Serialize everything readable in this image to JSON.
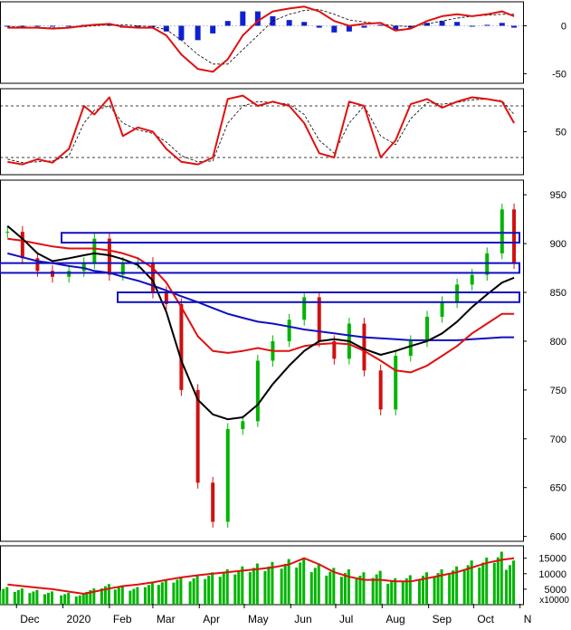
{
  "chart_data": [
    {
      "type": "line",
      "panel": "macd",
      "y_ticks": [
        "0",
        "-50"
      ],
      "ylim": [
        -60,
        25
      ],
      "series": [],
      "x": [
        "2019-11-25",
        "2019-12-05",
        "2019-12-15",
        "2019-12-25",
        "2020-01-05",
        "2020-01-15",
        "2020-01-22",
        "2020-02-01",
        "2020-02-10",
        "2020-02-20",
        "2020-03-01",
        "2020-03-10",
        "2020-03-20",
        "2020-03-31",
        "2020-04-10",
        "2020-04-20",
        "2020-04-30",
        "2020-05-10",
        "2020-05-20",
        "2020-05-31",
        "2020-06-10",
        "2020-06-20",
        "2020-06-30",
        "2020-07-10",
        "2020-07-20",
        "2020-07-31",
        "2020-08-10",
        "2020-08-20",
        "2020-08-31",
        "2020-09-10",
        "2020-09-20",
        "2020-09-30",
        "2020-10-10",
        "2020-10-20",
        "2020-10-28"
      ],
      "macd": [
        -2,
        -2,
        -2,
        -3,
        -2,
        0,
        1,
        2,
        -1,
        -2,
        -2,
        -10,
        -30,
        -45,
        -48,
        -35,
        -10,
        5,
        15,
        18,
        20,
        15,
        5,
        0,
        2,
        3,
        -5,
        -3,
        5,
        10,
        12,
        10,
        12,
        15,
        10
      ],
      "signal": [
        -1,
        -1,
        -2,
        -2,
        -2,
        -1,
        0,
        1,
        1,
        0,
        -1,
        -4,
        -15,
        -30,
        -40,
        -40,
        -25,
        -10,
        5,
        12,
        16,
        17,
        12,
        6,
        4,
        2,
        0,
        -1,
        2,
        5,
        8,
        10,
        11,
        12,
        12
      ],
      "histogram": [
        -1,
        -1,
        0,
        -1,
        0,
        1,
        1,
        1,
        -2,
        -2,
        -1,
        -6,
        -15,
        -15,
        -8,
        5,
        15,
        15,
        10,
        6,
        4,
        -2,
        -7,
        -6,
        -2,
        1,
        -5,
        -2,
        3,
        5,
        4,
        0,
        1,
        3,
        -2
      ]
    },
    {
      "type": "line",
      "panel": "stochastic",
      "y_ticks": [
        "50"
      ],
      "ylim": [
        0,
        100
      ],
      "reference_lines": [
        80,
        20
      ],
      "series": [],
      "x": [
        "2019-11-25",
        "2019-12-05",
        "2019-12-15",
        "2019-12-25",
        "2020-01-05",
        "2020-01-15",
        "2020-01-22",
        "2020-02-01",
        "2020-02-10",
        "2020-02-20",
        "2020-03-01",
        "2020-03-10",
        "2020-03-20",
        "2020-03-31",
        "2020-04-10",
        "2020-04-20",
        "2020-04-30",
        "2020-05-10",
        "2020-05-20",
        "2020-05-31",
        "2020-06-10",
        "2020-06-20",
        "2020-06-30",
        "2020-07-10",
        "2020-07-20",
        "2020-07-31",
        "2020-08-10",
        "2020-08-20",
        "2020-08-31",
        "2020-09-10",
        "2020-09-20",
        "2020-09-30",
        "2020-10-10",
        "2020-10-20",
        "2020-10-28"
      ],
      "k": [
        15,
        12,
        18,
        14,
        30,
        80,
        70,
        90,
        45,
        55,
        50,
        30,
        15,
        12,
        20,
        88,
        92,
        80,
        85,
        80,
        60,
        25,
        20,
        85,
        80,
        20,
        40,
        82,
        88,
        78,
        85,
        90,
        88,
        85,
        60
      ],
      "d": [
        18,
        14,
        15,
        16,
        22,
        60,
        75,
        80,
        60,
        52,
        48,
        38,
        22,
        15,
        16,
        60,
        80,
        85,
        84,
        82,
        70,
        40,
        25,
        60,
        80,
        45,
        35,
        65,
        84,
        82,
        84,
        87,
        88,
        86,
        70
      ]
    },
    {
      "type": "line",
      "panel": "price",
      "y_ticks": [
        "950",
        "900",
        "850",
        "800",
        "750",
        "700",
        "650",
        "600"
      ],
      "ylim": [
        595,
        965
      ],
      "series": [],
      "x": [
        "2019-11-25",
        "2019-12-05",
        "2019-12-15",
        "2019-12-25",
        "2020-01-05",
        "2020-01-15",
        "2020-01-22",
        "2020-02-01",
        "2020-02-10",
        "2020-02-20",
        "2020-03-01",
        "2020-03-10",
        "2020-03-20",
        "2020-03-31",
        "2020-04-10",
        "2020-04-20",
        "2020-04-30",
        "2020-05-10",
        "2020-05-20",
        "2020-05-31",
        "2020-06-10",
        "2020-06-20",
        "2020-06-30",
        "2020-07-10",
        "2020-07-20",
        "2020-07-31",
        "2020-08-10",
        "2020-08-20",
        "2020-08-31",
        "2020-09-10",
        "2020-09-20",
        "2020-09-30",
        "2020-10-10",
        "2020-10-20",
        "2020-10-28"
      ],
      "close": [
        912,
        885,
        872,
        866,
        872,
        880,
        905,
        868,
        880,
        880,
        850,
        838,
        750,
        655,
        615,
        710,
        718,
        780,
        800,
        822,
        845,
        800,
        782,
        818,
        770,
        730,
        785,
        800,
        825,
        840,
        858,
        868,
        890,
        935,
        880
      ],
      "ma_black": [
        918,
        905,
        890,
        882,
        885,
        888,
        890,
        888,
        884,
        878,
        862,
        830,
        780,
        740,
        725,
        720,
        722,
        735,
        756,
        775,
        790,
        800,
        802,
        800,
        792,
        786,
        790,
        795,
        800,
        808,
        820,
        835,
        848,
        860,
        865
      ],
      "ma_red": [
        905,
        903,
        900,
        897,
        895,
        895,
        895,
        893,
        890,
        885,
        875,
        860,
        835,
        805,
        790,
        788,
        790,
        793,
        790,
        790,
        795,
        797,
        798,
        797,
        790,
        780,
        770,
        768,
        775,
        785,
        795,
        808,
        818,
        828,
        828
      ],
      "ma_blue": [
        890,
        886,
        882,
        880,
        877,
        875,
        872,
        870,
        866,
        862,
        857,
        852,
        846,
        840,
        834,
        828,
        824,
        820,
        818,
        815,
        812,
        810,
        808,
        806,
        804,
        803,
        802,
        801,
        801,
        801,
        801,
        802,
        803,
        804,
        804
      ],
      "zones": [
        [
          901,
          911
        ],
        [
          870,
          880
        ],
        [
          840,
          850
        ]
      ]
    },
    {
      "type": "bar",
      "panel": "volume",
      "y_ticks": [
        "15000",
        "10000",
        "5000"
      ],
      "unit_label": "x10000",
      "ylim": [
        0,
        19000
      ],
      "series": [],
      "x": [
        "2019-11-25",
        "2019-12-05",
        "2019-12-15",
        "2019-12-25",
        "2020-01-05",
        "2020-01-15",
        "2020-01-22",
        "2020-02-01",
        "2020-02-10",
        "2020-02-20",
        "2020-03-01",
        "2020-03-10",
        "2020-03-20",
        "2020-03-31",
        "2020-04-10",
        "2020-04-20",
        "2020-04-30",
        "2020-05-10",
        "2020-05-20",
        "2020-05-31",
        "2020-06-10",
        "2020-06-20",
        "2020-06-30",
        "2020-07-10",
        "2020-07-20",
        "2020-07-31",
        "2020-08-10",
        "2020-08-20",
        "2020-08-31",
        "2020-09-10",
        "2020-09-20",
        "2020-09-30",
        "2020-10-10",
        "2020-10-20",
        "2020-10-28"
      ],
      "volume": [
        6000,
        5500,
        5000,
        4500,
        4000,
        3500,
        5500,
        7000,
        6500,
        6000,
        7500,
        8500,
        9500,
        10000,
        11000,
        12000,
        13000,
        14000,
        14500,
        15500,
        16000,
        14000,
        12500,
        12000,
        11000,
        11500,
        9000,
        10000,
        11000,
        12000,
        13000,
        15000,
        16000,
        18000,
        15000
      ],
      "volume_ma": [
        6500,
        6000,
        5500,
        5000,
        4200,
        3500,
        4200,
        5200,
        6000,
        6500,
        7200,
        8000,
        8800,
        9500,
        10000,
        10500,
        11000,
        11500,
        12000,
        13000,
        15000,
        13000,
        10500,
        9000,
        8000,
        8000,
        7500,
        7500,
        8500,
        9500,
        10500,
        12000,
        13500,
        14500,
        15000
      ]
    }
  ],
  "x_axis": {
    "labels": [
      "Dec",
      "2020",
      "Feb",
      "Mar",
      "Apr",
      "May",
      "Jun",
      "Jul",
      "Aug",
      "Sep",
      "Oct",
      "N"
    ],
    "positions": [
      "2019-12-01",
      "2020-01-01",
      "2020-02-01",
      "2020-03-01",
      "2020-04-01",
      "2020-05-01",
      "2020-06-01",
      "2020-07-01",
      "2020-08-01",
      "2020-09-01",
      "2020-10-01",
      "2020-11-01"
    ]
  },
  "colors": {
    "up": "#00b400",
    "down": "#d01010",
    "red_line": "#e01010",
    "black_line": "#000000",
    "blue_line": "#1010c0",
    "zone_border": "#1010c0",
    "hist": "#1020d0",
    "volume_bar": "#00b400",
    "axis": "#000000",
    "grid": "#000000"
  }
}
